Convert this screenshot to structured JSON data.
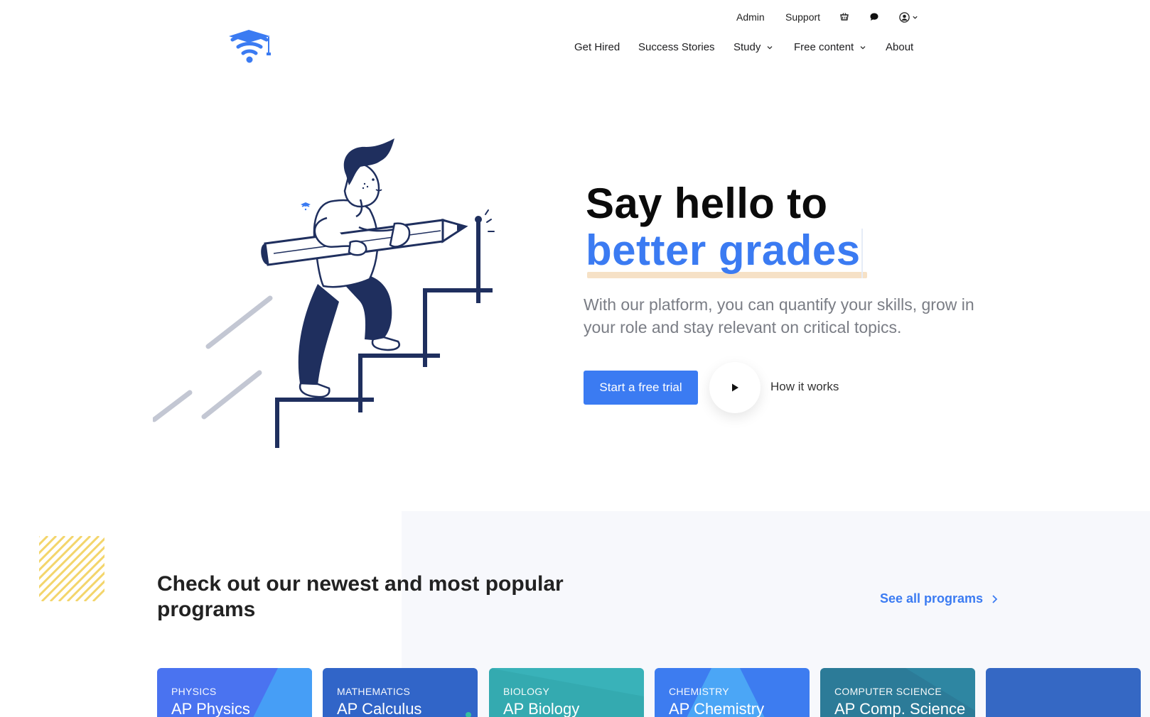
{
  "utility_nav": {
    "admin": "Admin",
    "support": "Support",
    "icons": [
      "cart-icon",
      "chat-icon",
      "user-icon",
      "chevron-down-icon"
    ]
  },
  "main_nav": {
    "items": [
      {
        "label": "Get Hired",
        "has_dropdown": false
      },
      {
        "label": "Success Stories",
        "has_dropdown": false
      },
      {
        "label": "Study",
        "has_dropdown": true
      },
      {
        "label": "Free content",
        "has_dropdown": true
      },
      {
        "label": "About",
        "has_dropdown": false
      }
    ]
  },
  "hero": {
    "title_line1": "Say hello to",
    "title_line2": "better grades",
    "subtitle": "With our platform, you can quantify your skills, grow in your role and stay relevant on critical topics.",
    "cta_primary": "Start a free trial",
    "cta_secondary": "How it works"
  },
  "programs": {
    "title": "Check out our newest and most popular programs",
    "see_all": "See all programs",
    "cards": [
      {
        "category": "PHYSICS",
        "name": "AP Physics",
        "color": "#4a73f0"
      },
      {
        "category": "MATHEMATICS",
        "name": "AP Calculus",
        "color": "#3165c8"
      },
      {
        "category": "BIOLOGY",
        "name": "AP Biology",
        "color": "#34aab0"
      },
      {
        "category": "CHEMISTRY",
        "name": "AP Chemistry",
        "color": "#3d7cf0"
      },
      {
        "category": "COMPUTER SCIENCE",
        "name": "AP Comp. Science",
        "color": "#2c7b98"
      },
      {
        "category": "",
        "name": "",
        "color": "#3568c4"
      }
    ]
  },
  "colors": {
    "accent": "#3b7bf2",
    "navy": "#1f2f5e",
    "underline": "#f6e1c6",
    "stripes": "#f3d56b"
  }
}
